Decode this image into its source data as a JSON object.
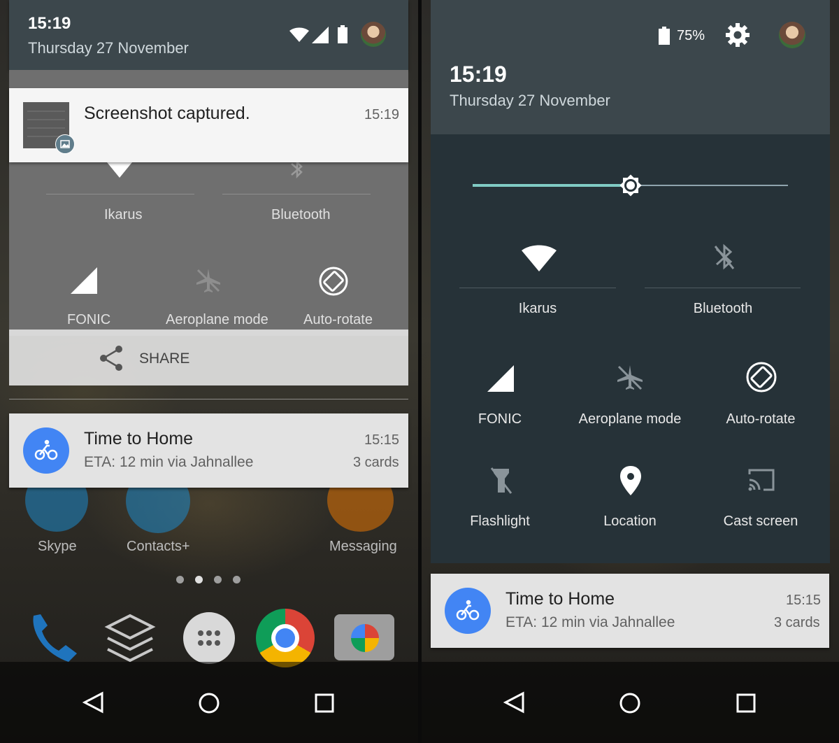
{
  "left": {
    "status": {
      "time": "15:19",
      "date": "Thursday 27 November"
    },
    "quick_settings": {
      "tiles": [
        {
          "label": "Ikarus",
          "icon": "wifi-icon"
        },
        {
          "label": "Bluetooth",
          "icon": "bluetooth-off-icon"
        },
        {
          "label": "FONIC",
          "icon": "cell-signal-icon"
        },
        {
          "label": "Aeroplane mode",
          "icon": "airplane-icon"
        },
        {
          "label": "Auto-rotate",
          "icon": "auto-rotate-icon"
        }
      ]
    },
    "screenshot_notification": {
      "title": "Screenshot captured.",
      "time": "15:19"
    },
    "share_action": {
      "label": "SHARE"
    },
    "home_notification": {
      "title": "Time to Home",
      "subtitle": "ETA: 12 min via Jahnallee",
      "time": "15:15",
      "count": "3 cards"
    },
    "home_apps": [
      {
        "label": "Skype"
      },
      {
        "label": "Contacts+"
      },
      {
        "label": "Messaging"
      }
    ]
  },
  "right": {
    "status": {
      "battery": "75%"
    },
    "header": {
      "time": "15:19",
      "date": "Thursday 27 November"
    },
    "brightness": {
      "level": 0.5
    },
    "tiles": [
      {
        "label": "Ikarus",
        "icon": "wifi-icon"
      },
      {
        "label": "Bluetooth",
        "icon": "bluetooth-off-icon"
      },
      {
        "label": "FONIC",
        "icon": "cell-signal-icon"
      },
      {
        "label": "Aeroplane mode",
        "icon": "airplane-icon"
      },
      {
        "label": "Auto-rotate",
        "icon": "auto-rotate-icon"
      },
      {
        "label": "Flashlight",
        "icon": "flashlight-icon"
      },
      {
        "label": "Location",
        "icon": "location-pin-icon"
      },
      {
        "label": "Cast screen",
        "icon": "cast-icon"
      }
    ],
    "home_notification": {
      "title": "Time to Home",
      "subtitle": "ETA: 12 min via Jahnallee",
      "time": "15:15",
      "count": "3 cards"
    }
  },
  "colors": {
    "accent": "#80cbc4",
    "notification_icon": "#4285f4",
    "qs_background": "#263238",
    "header_background": "#3c474c"
  }
}
